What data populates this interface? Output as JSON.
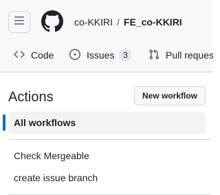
{
  "header": {
    "owner": "co-KKIRI",
    "separator": "/",
    "repo": "FE_co-KKIRI",
    "menu_icon": "hamburger-icon",
    "logo_icon": "github-mark-icon"
  },
  "tabs": [
    {
      "label": "Code",
      "icon": "code-icon"
    },
    {
      "label": "Issues",
      "icon": "issue-icon",
      "count": "3"
    },
    {
      "label": "Pull requests",
      "icon": "pull-request-icon"
    }
  ],
  "actions": {
    "title": "Actions",
    "new_workflow_label": "New workflow",
    "all_workflows_label": "All workflows",
    "workflows": [
      "Check Mergeable",
      "create issue branch"
    ]
  },
  "colors": {
    "accent": "#0969da",
    "border": "#d0d7de",
    "header_bg": "#f6f8fa"
  }
}
